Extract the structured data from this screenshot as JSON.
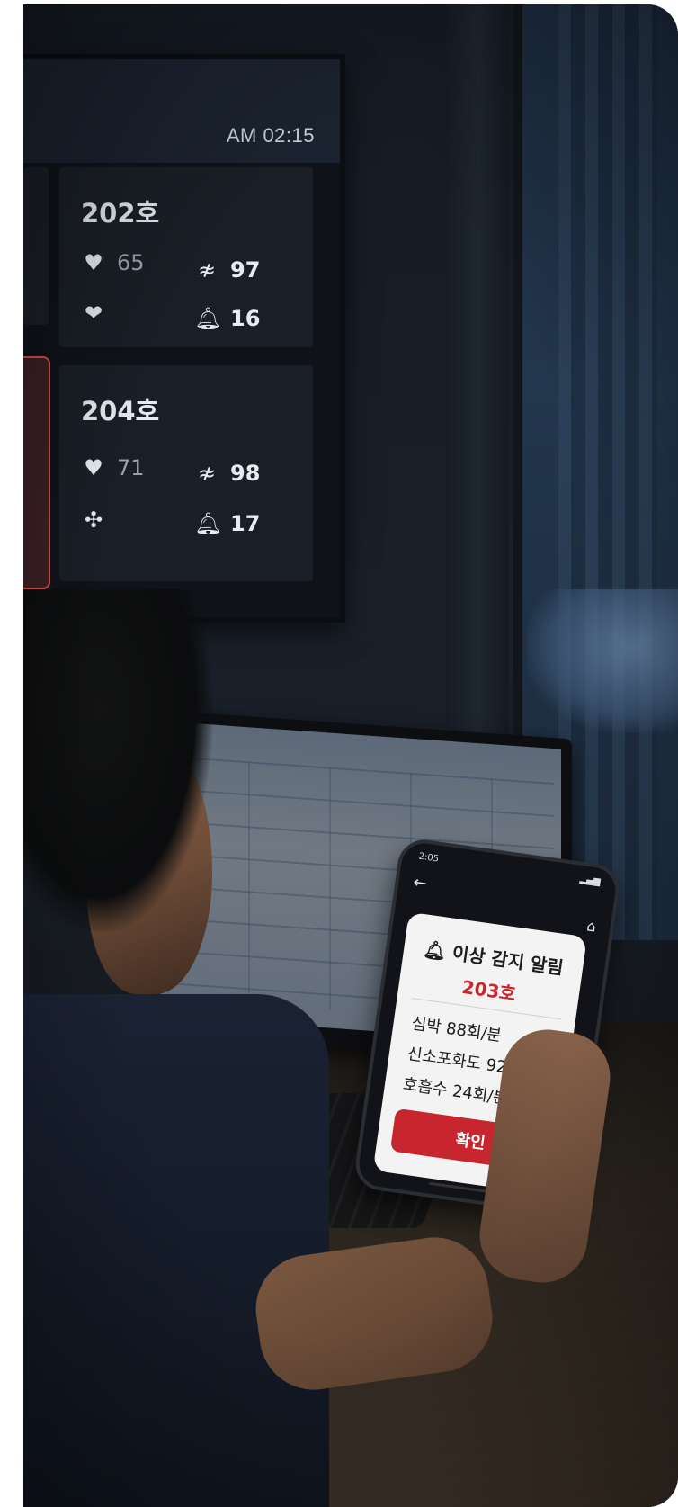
{
  "wall_monitor": {
    "clock": "AM 02:15",
    "rooms": [
      {
        "title": "202호",
        "heart_rate": "65",
        "spo2": "97",
        "resp_rate": "16"
      },
      {
        "title": "204호",
        "heart_rate": "71",
        "spo2": "98",
        "resp_rate": "17"
      }
    ]
  },
  "phone": {
    "status_time": "2:05",
    "alert": {
      "title": "이상 감지 알림",
      "room": "203호",
      "heart_rate": "심박 88회/분",
      "spo2": "신소포화도 92%",
      "resp_rate": "호흡수  24회/분",
      "confirm_label": "확인"
    }
  },
  "colors": {
    "alert_red": "#c8262e",
    "alert_border": "#d64a4a",
    "card_bg": "#f3f3f3"
  },
  "icons": [
    "heart-icon",
    "heartbeat-icon",
    "spo2-icon",
    "bell-icon",
    "back-arrow-icon",
    "home-icon"
  ]
}
